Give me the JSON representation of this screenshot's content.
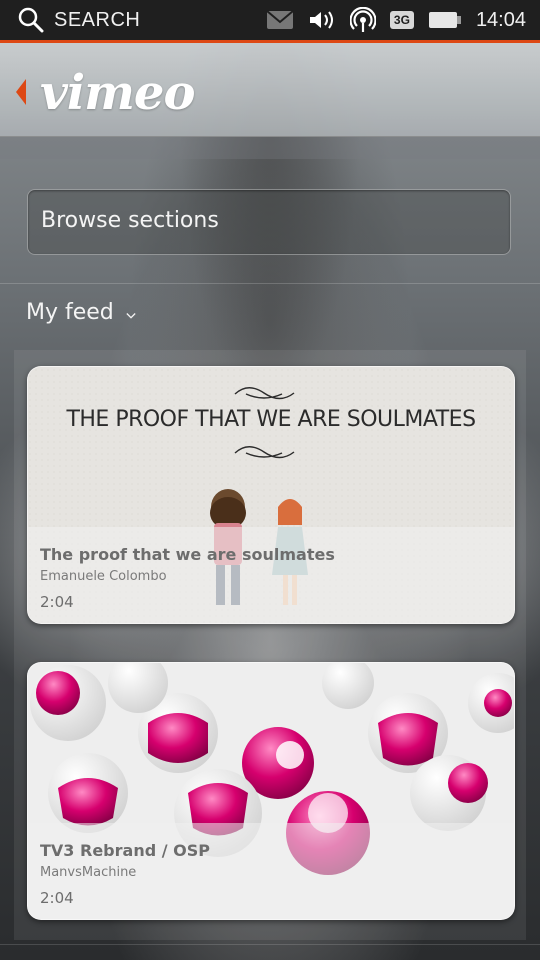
{
  "status_bar": {
    "search_label": "SEARCH",
    "network_badge": "3G",
    "time": "14:04"
  },
  "header": {
    "app_logo": "vimeo"
  },
  "browse": {
    "label": "Browse sections"
  },
  "feed": {
    "label": "My feed",
    "items": [
      {
        "thumbnail_text": "THE PROOF THAT WE ARE SOULMATES",
        "title": "The proof that we are soulmates",
        "author": "Emanuele Colombo",
        "duration": "2:04"
      },
      {
        "title": "TV3 Rebrand / OSP",
        "author": "ManvsMachine",
        "duration": "2:04"
      }
    ]
  },
  "colors": {
    "accent": "#dd4814",
    "status_bar": "#1f1f1f",
    "thumb_magenta": "#d6006e"
  }
}
